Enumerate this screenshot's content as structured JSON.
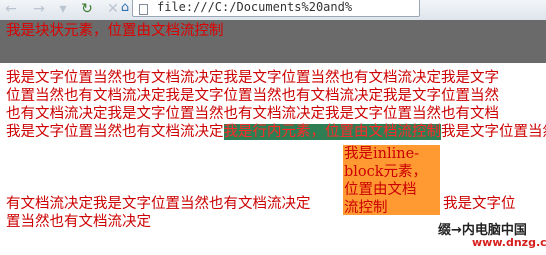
{
  "browser": {
    "url": "file:///C:/Documents%20and%",
    "icons": [
      "back-icon",
      "forward-icon",
      "reload-icon",
      "home-icon",
      "page-icon"
    ]
  },
  "page": {
    "block_text": "我是块状元素，位置由文档流控制",
    "lines": [
      "我是文字位置当然也有文档流决定我是文字位置当然也有文档流决定我是文字",
      "位置当然也有文档流决定我是文字位置当然也有文档流决定我是文字位置当然",
      "也有文档流决定我是文字位置当然也有文档流决定我是文字位置当然也有文档",
      "流决定我是文字位置当然也有文档流决定我是文字位置当然也有文档流决定"
    ],
    "line5_prefix": "我是文字位置当然也有文档流决定",
    "inline_text": "我是行内元素，位置由文档流控制",
    "line5_suffix": "我是文字位置当然也",
    "ib_lines": [
      "我是inline-",
      "block元素，",
      "位置由文档",
      "流控制"
    ],
    "line6_prefix": "有文档流决定我是文字位置当然也有文档流决定",
    "line6_suffix": "我是文字位",
    "line7": "置当然也有文档流决定"
  },
  "watermark": {
    "line1": "缀→内电脑中国",
    "line2": "www.dnzg.cn"
  },
  "colors": {
    "text": "#cc0000",
    "block_bg": "#6a6a6a",
    "inline_bg": "#2f7d52",
    "inline_block_bg": "#ff9a33"
  }
}
